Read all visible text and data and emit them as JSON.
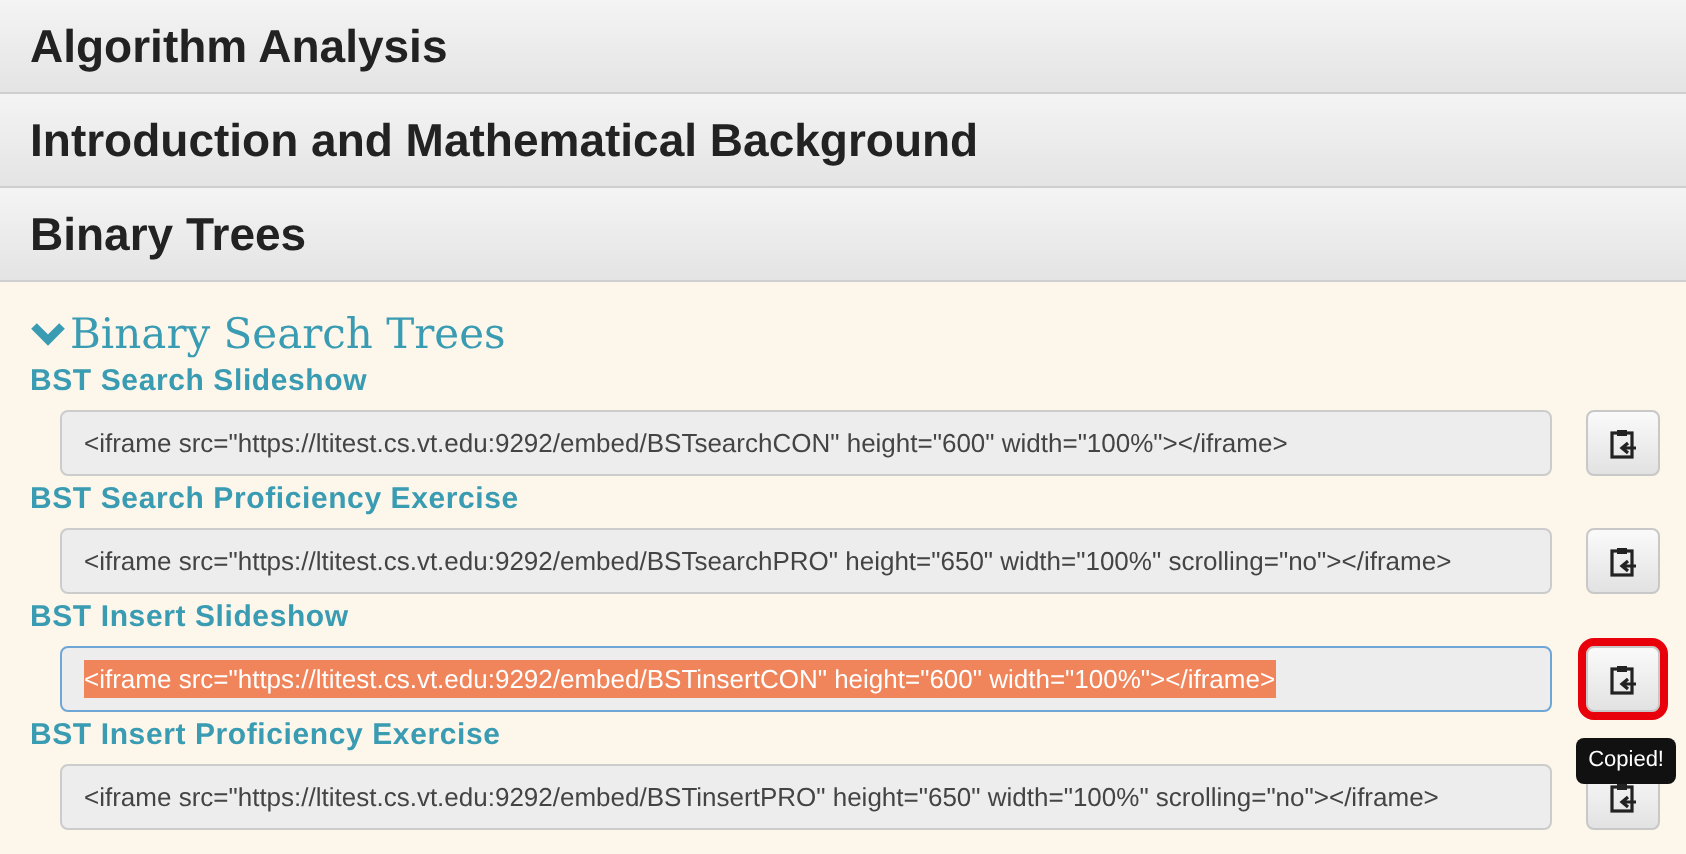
{
  "chapters": [
    {
      "title": "Algorithm Analysis"
    },
    {
      "title": "Introduction and Mathematical Background"
    },
    {
      "title": "Binary Trees"
    }
  ],
  "section": {
    "title": "Binary Search Trees",
    "expanded": true
  },
  "items": [
    {
      "label": "BST Search Slideshow",
      "code": "<iframe src=\"https://ltitest.cs.vt.edu:9292/embed/BSTsearchCON\" height=\"600\" width=\"100%\"></iframe>",
      "selected": false,
      "copied": false
    },
    {
      "label": "BST Search Proficiency Exercise",
      "code": "<iframe src=\"https://ltitest.cs.vt.edu:9292/embed/BSTsearchPRO\" height=\"650\" width=\"100%\" scrolling=\"no\"></iframe>",
      "selected": false,
      "copied": false
    },
    {
      "label": "BST Insert Slideshow",
      "code": "<iframe src=\"https://ltitest.cs.vt.edu:9292/embed/BSTinsertCON\" height=\"600\" width=\"100%\"></iframe>",
      "selected": true,
      "copied": true
    },
    {
      "label": "BST Insert Proficiency Exercise",
      "code": "<iframe src=\"https://ltitest.cs.vt.edu:9292/embed/BSTinsertPRO\" height=\"650\" width=\"100%\" scrolling=\"no\"></iframe>",
      "selected": false,
      "copied": false
    }
  ],
  "tooltip": "Copied!"
}
